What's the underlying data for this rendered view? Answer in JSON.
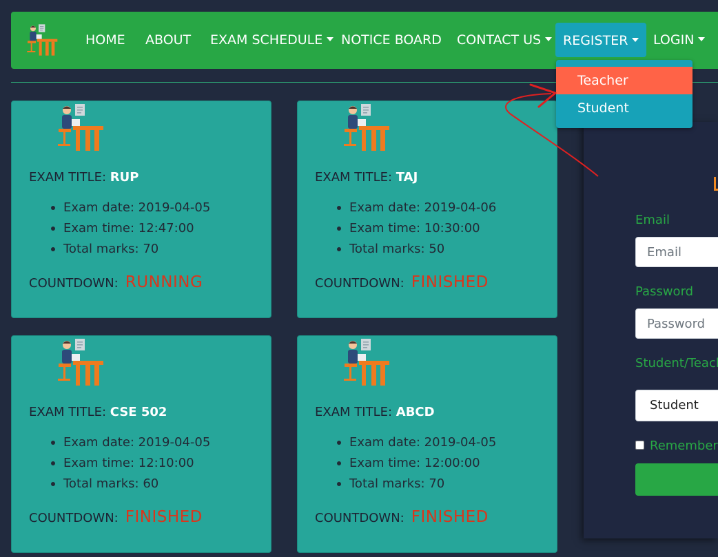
{
  "navbar": {
    "items": [
      {
        "label": "HOME"
      },
      {
        "label": "ABOUT"
      },
      {
        "label": "EXAM SCHEDULE"
      },
      {
        "label": "NOTICE BOARD"
      },
      {
        "label": "CONTACT US"
      },
      {
        "label": "REGISTER"
      },
      {
        "label": "LOGIN"
      }
    ]
  },
  "register_dropdown": {
    "items": [
      {
        "label": "Teacher"
      },
      {
        "label": "Student"
      }
    ]
  },
  "exams": [
    {
      "title_label": "EXAM TITLE:",
      "title": "RUP",
      "details": [
        "Exam date: 2019-04-05",
        "Exam time: 12:47:00",
        "Total marks: 70"
      ],
      "countdown_label": "COUNTDOWN:",
      "countdown": "RUNNING"
    },
    {
      "title_label": "EXAM TITLE:",
      "title": "TAJ",
      "details": [
        "Exam date: 2019-04-06",
        "Exam time: 10:30:00",
        "Total marks: 50"
      ],
      "countdown_label": "COUNTDOWN:",
      "countdown": "FINISHED"
    },
    {
      "title_label": "EXAM TITLE:",
      "title": "CSE 502",
      "details": [
        "Exam date: 2019-04-05",
        "Exam time: 12:10:00",
        "Total marks: 60"
      ],
      "countdown_label": "COUNTDOWN:",
      "countdown": "FINISHED"
    },
    {
      "title_label": "EXAM TITLE:",
      "title": "ABCD",
      "details": [
        "Exam date: 2019-04-05",
        "Exam time: 12:00:00",
        "Total marks: 70"
      ],
      "countdown_label": "COUNTDOWN:",
      "countdown": "FINISHED"
    }
  ],
  "login_form": {
    "email_label": "Email",
    "email_placeholder": "Email",
    "password_label": "Password",
    "password_placeholder": "Password",
    "role_label": "Student/Teacher",
    "role_selected": "Student",
    "remember_label": "Remember me"
  },
  "icons": {
    "logo": "teacher-desk-icon",
    "card": "person-at-desk-icon",
    "caret": "caret-down-icon"
  },
  "colors": {
    "navbar": "#28a745",
    "register_active": "#17a2b8",
    "dropdown_hover": "#ff6347",
    "card_bg": "#26a69a",
    "countdown_text": "#d9361c",
    "page_bg": "#212a3e"
  }
}
